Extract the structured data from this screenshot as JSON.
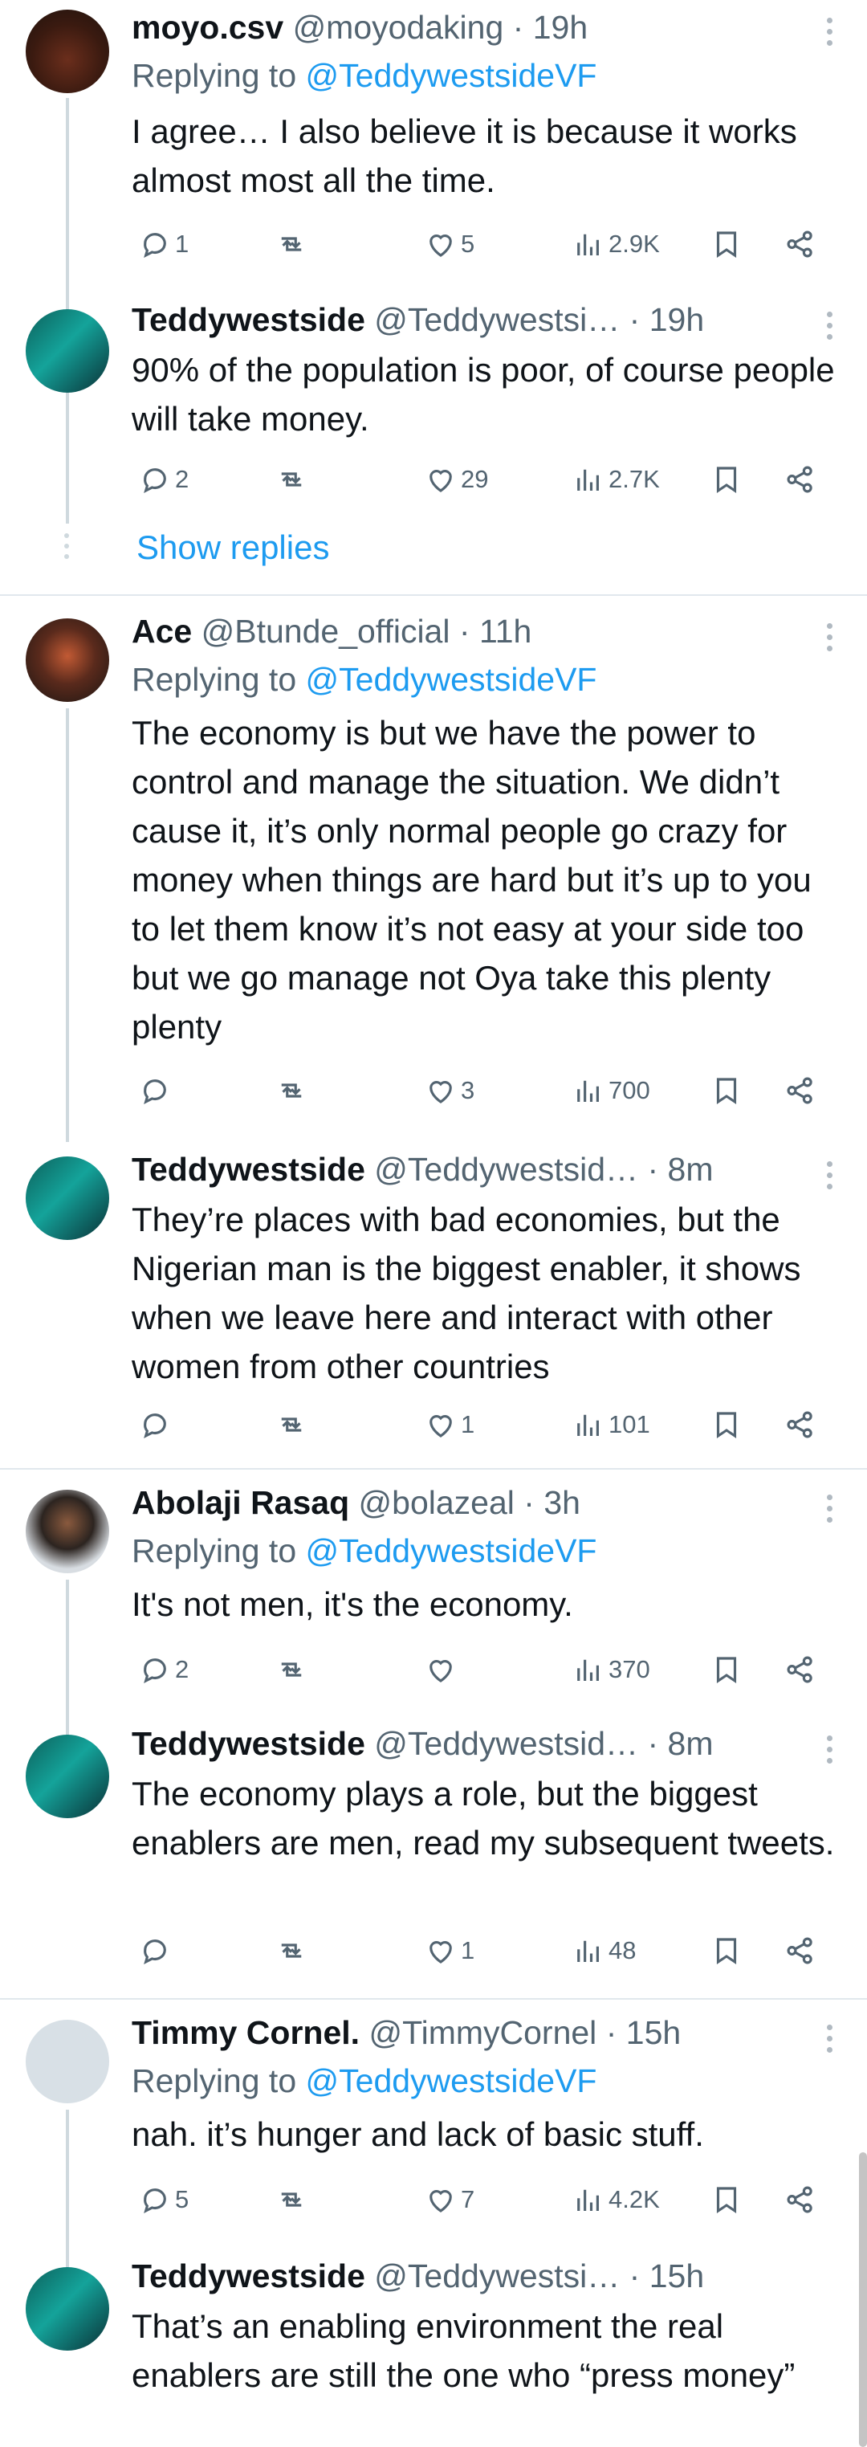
{
  "tweets": [
    {
      "name": "moyo.csv",
      "handle": "@moyodaking",
      "time": "19h",
      "replying_prefix": "Replying to",
      "replying_to": "@TeddywestsideVF",
      "text": "I agree… I also believe it is because it works almost most all the time.",
      "replies": "1",
      "retweets": "",
      "likes": "5",
      "views": "2.9K"
    },
    {
      "name": "Teddywestside",
      "handle": "@Teddywestsi…",
      "time": "19h",
      "replying_prefix": "",
      "replying_to": "",
      "text": "90% of the population is poor, of course people will take money.",
      "replies": "2",
      "retweets": "",
      "likes": "29",
      "views": "2.7K"
    },
    {
      "name": "Ace",
      "handle": "@Btunde_official",
      "time": "11h",
      "replying_prefix": "Replying to",
      "replying_to": "@TeddywestsideVF",
      "text": "The economy is but we have the power to control and manage the situation. We didn’t cause it, it’s only normal people go crazy for money when things are hard but it’s up to you to let them know it’s not easy at your side too but we go manage not Oya take this plenty plenty",
      "replies": "",
      "retweets": "",
      "likes": "3",
      "views": "700"
    },
    {
      "name": "Teddywestside",
      "handle": "@Teddywestsid…",
      "time": "8m",
      "replying_prefix": "",
      "replying_to": "",
      "text": "They’re places with bad economies, but the Nigerian man is the biggest enabler, it shows when we leave here and interact with other women from other countries",
      "replies": "",
      "retweets": "",
      "likes": "1",
      "views": "101"
    },
    {
      "name": "Abolaji Rasaq",
      "handle": "@bolazeal",
      "time": "3h",
      "replying_prefix": "Replying to",
      "replying_to": "@TeddywestsideVF",
      "text": "It's not men, it's the economy.",
      "replies": "2",
      "retweets": "",
      "likes": "",
      "views": "370"
    },
    {
      "name": "Teddywestside",
      "handle": "@Teddywestsid…",
      "time": "8m",
      "replying_prefix": "",
      "replying_to": "",
      "text": "The economy plays a role, but the biggest enablers are men, read my subsequent tweets.",
      "replies": "",
      "retweets": "",
      "likes": "1",
      "views": "48"
    },
    {
      "name": "Timmy Cornel.",
      "handle": "@TimmyCornel",
      "time": "15h",
      "replying_prefix": "Replying to",
      "replying_to": "@TeddywestsideVF",
      "text": "nah. it’s hunger and lack of basic stuff.",
      "replies": "5",
      "retweets": "",
      "likes": "7",
      "views": "4.2K"
    },
    {
      "name": "Teddywestside",
      "handle": "@Teddywestsi…",
      "time": "15h",
      "replying_prefix": "",
      "replying_to": "",
      "text": "That’s an enabling environment the real enablers are still the one who “press money”",
      "replies": "",
      "retweets": "",
      "likes": "",
      "views": ""
    }
  ],
  "show_replies_label": "Show replies",
  "separator": "·",
  "icons": [
    "reply-icon",
    "retweet-icon",
    "like-icon",
    "views-icon",
    "bookmark-icon",
    "share-icon",
    "more-icon"
  ],
  "colors": {
    "link": "#1d9bf0",
    "secondary": "#536471",
    "divider": "#e1e8ed",
    "thread_line": "#cfd9de"
  }
}
